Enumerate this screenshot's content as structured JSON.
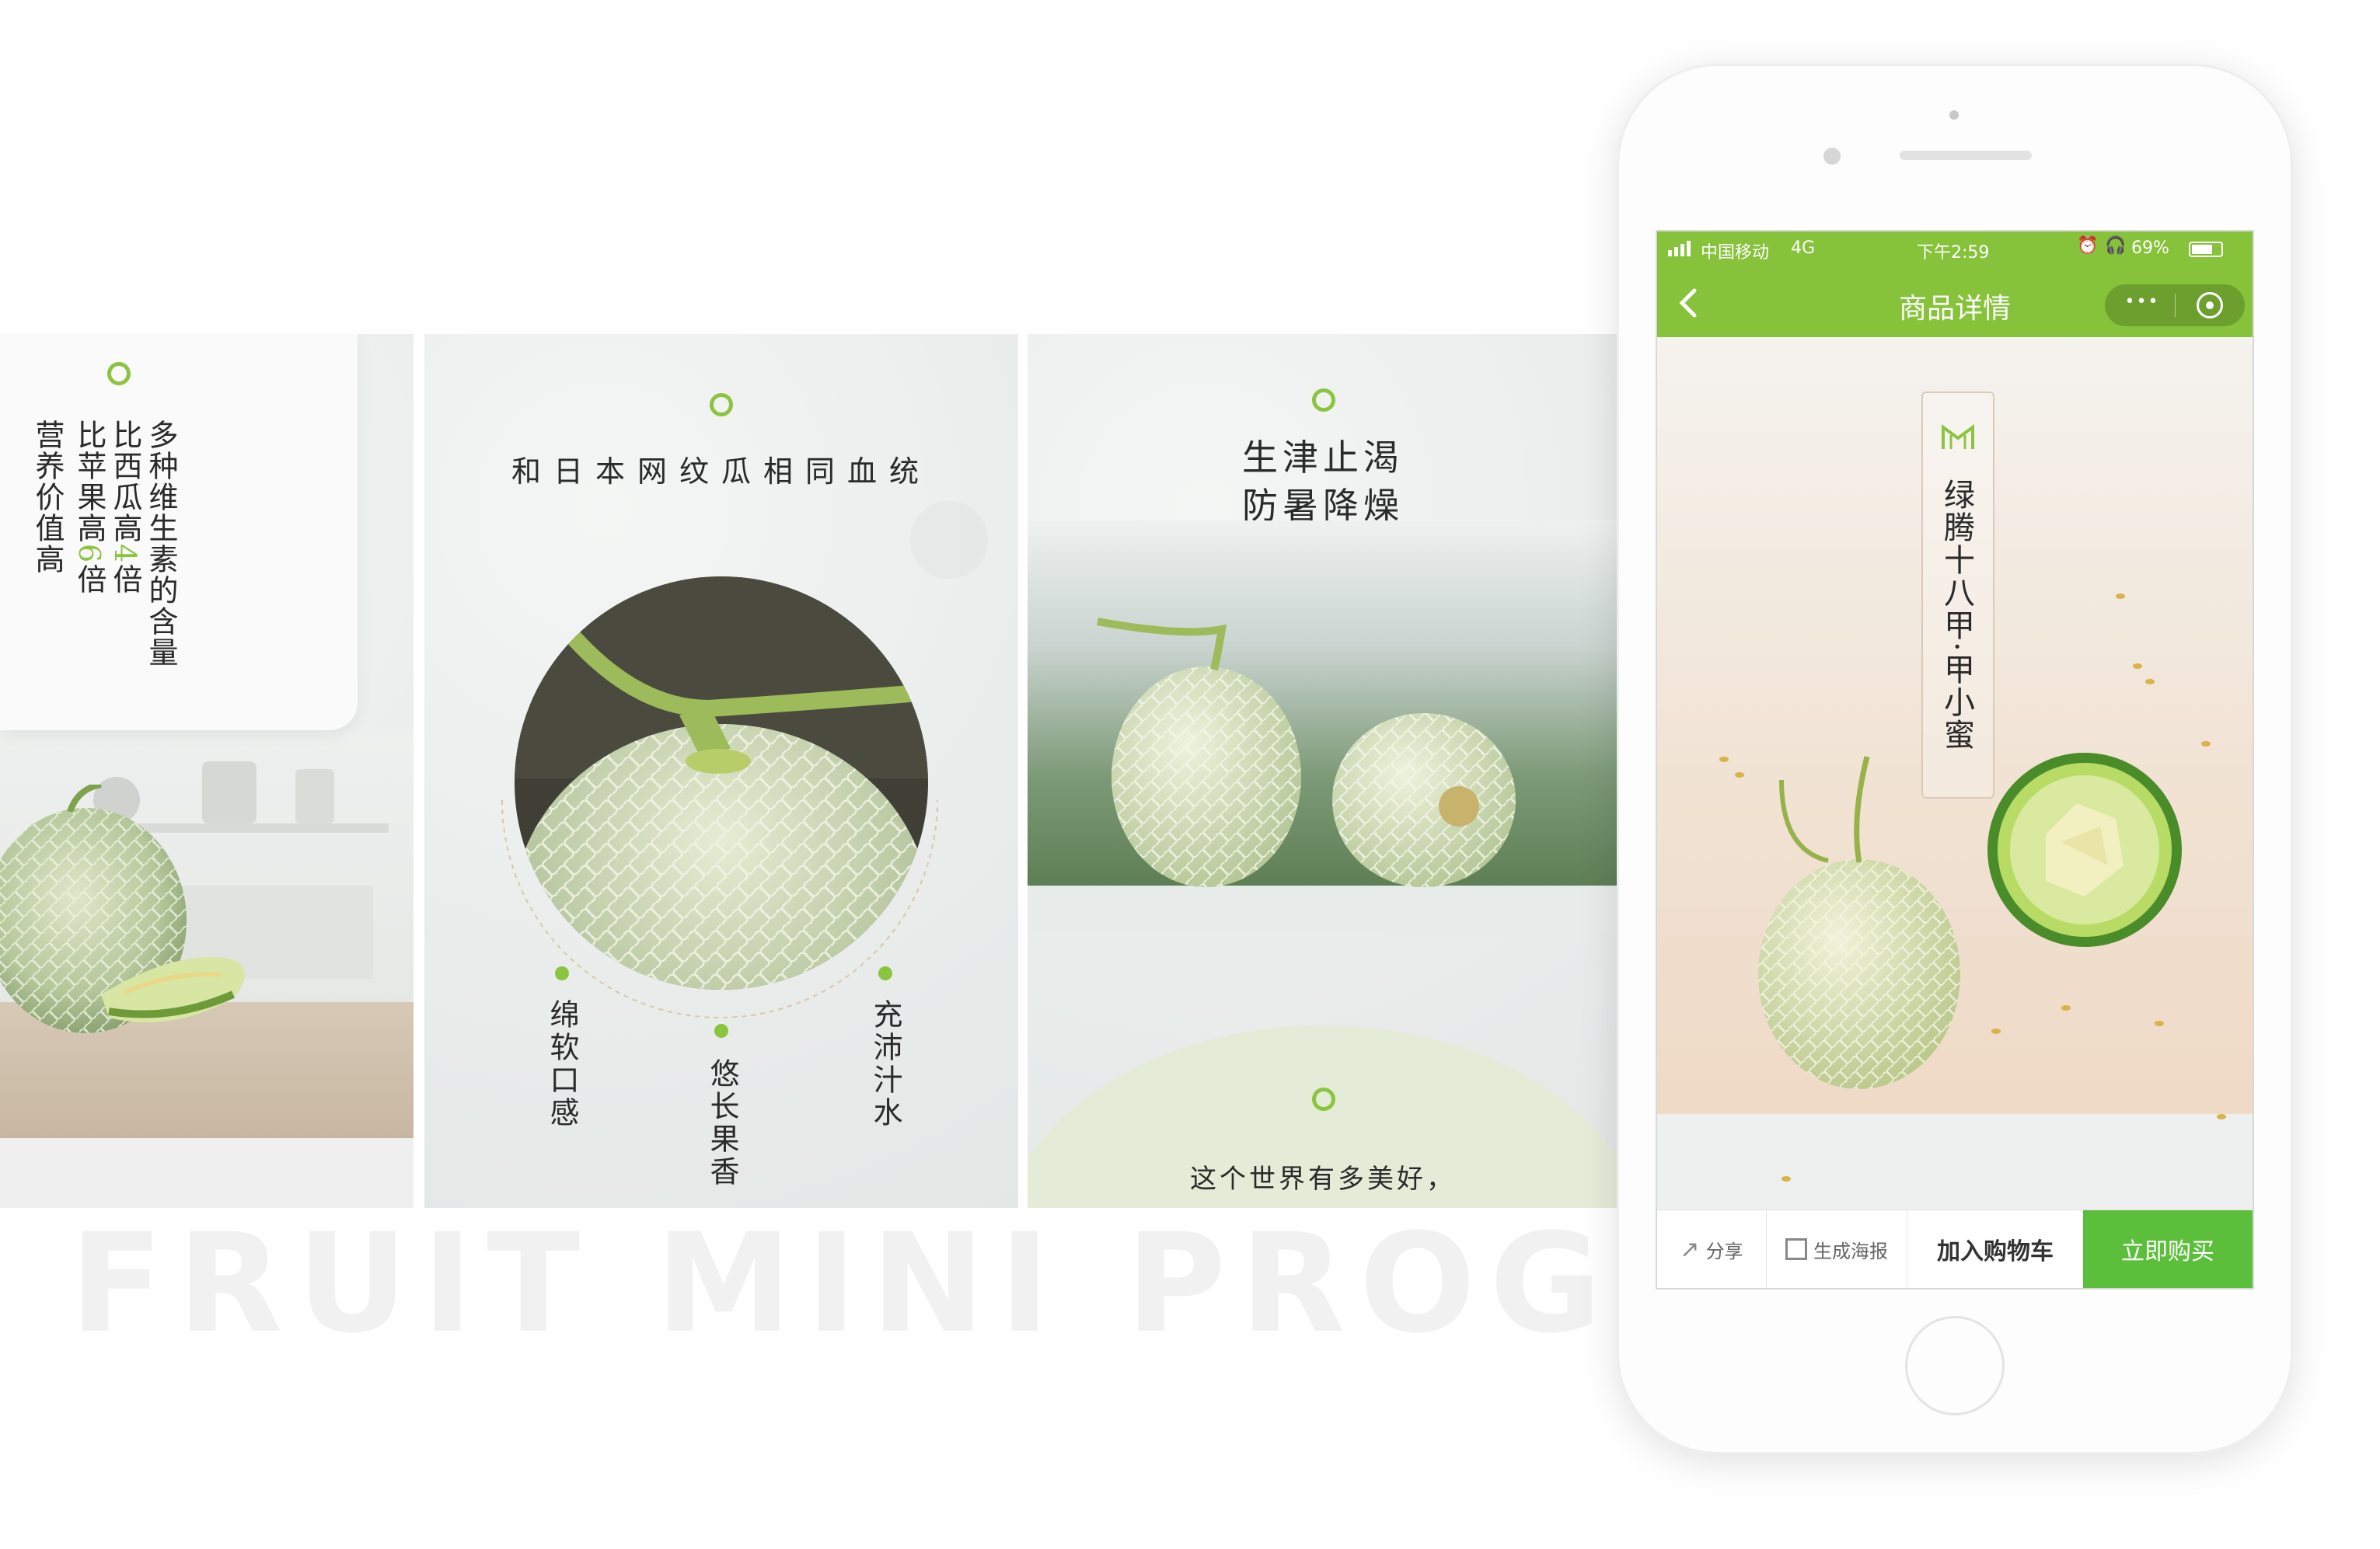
{
  "watermark": "FRUIT MINI  PROGRAM",
  "panel1": {
    "col1": "营养价值高",
    "col2_pre": "比苹果高",
    "col2_num": "6",
    "col2_post": "倍",
    "col3_pre": "比西瓜高",
    "col3_num": "4",
    "col3_post": "倍",
    "col4": "多种维生素的含量"
  },
  "panel2": {
    "title": "和日本网纹瓜相同血统",
    "feature_left": "绵软口感",
    "feature_center": "悠长果香",
    "feature_right": "充沛汁水"
  },
  "panel3": {
    "title_line1": "生津止渴",
    "title_line2": "防暑降燥",
    "bottom_text": "这个世界有多美好，"
  },
  "phone": {
    "status": {
      "carrier": "中国移动",
      "network": "4G",
      "time": "下午2:59",
      "battery": "69%"
    },
    "nav": {
      "title": "商品详情",
      "more_label": "•••"
    },
    "product_name": "绿腾十八甲·甲小蜜",
    "bottom_bar": {
      "share": "分享",
      "poster": "生成海报",
      "add_cart": "加入购物车",
      "buy_now": "立即购买"
    }
  },
  "colors": {
    "accent_green": "#8bc53f",
    "nav_green": "#86c23a",
    "buy_green": "#5cbf3c"
  }
}
